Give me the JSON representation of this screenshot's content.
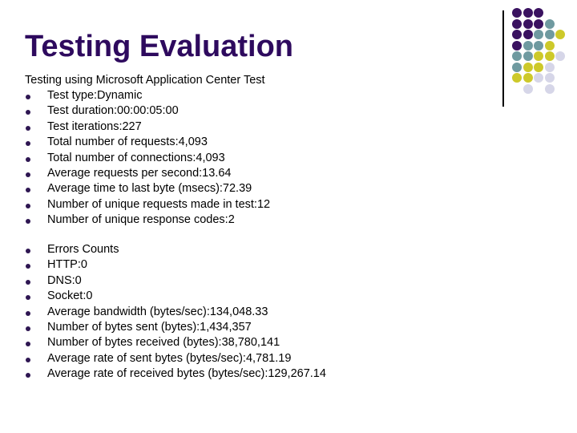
{
  "slide": {
    "title": "Testing Evaluation",
    "intro": "Testing using Microsoft Application Center Test",
    "list1": [
      "Test type:Dynamic",
      "Test duration:00:00:05:00",
      "Test iterations:227",
      "Total number of requests:4,093",
      "Total number of connections:4,093",
      "Average requests per second:13.64",
      "Average time to last byte (msecs):72.39",
      "Number of unique requests made in test:12",
      "Number of unique response codes:2"
    ],
    "list2": [
      "Errors Counts",
      "HTTP:0",
      "DNS:0",
      "Socket:0",
      "Average bandwidth (bytes/sec):134,048.33",
      "Number of bytes sent (bytes):1,434,357",
      "Number of bytes received (bytes):38,780,141",
      "Average rate of sent bytes (bytes/sec):4,781.19",
      "Average rate of received bytes (bytes/sec):129,267.14"
    ]
  },
  "decoration": {
    "colors": {
      "P": "#3a1260",
      "T": "#6f9aa0",
      "Y": "#cdc92a",
      "L": "#d6d6e8"
    },
    "grid": [
      "PPP..",
      "PPPT.",
      "PPTTY",
      "PTTY.",
      "TTYYL",
      "TYYL.",
      "YYLL.",
      ".L.L."
    ]
  },
  "colors": {
    "title": "#2e0a5e",
    "bullet": "#2e1652"
  }
}
